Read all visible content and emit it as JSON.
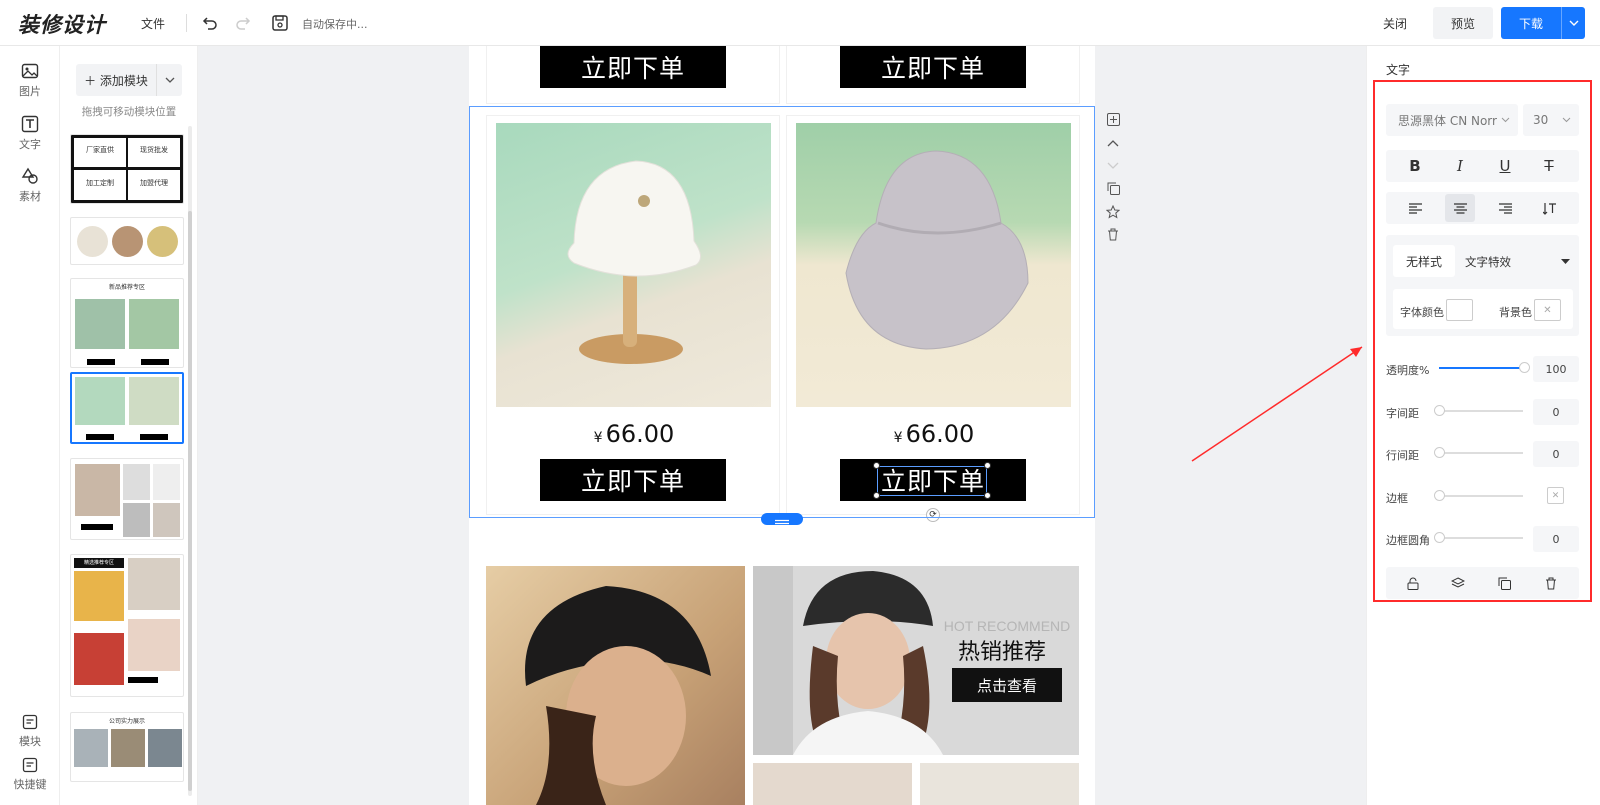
{
  "header": {
    "logo": "装修设计",
    "file_menu": "文件",
    "autosave_status": "自动保存中...",
    "close_label": "关闭",
    "preview_label": "预览",
    "download_label": "下载"
  },
  "rail": {
    "items": [
      {
        "label": "图片",
        "icon": "image-icon"
      },
      {
        "label": "文字",
        "icon": "text-icon"
      },
      {
        "label": "素材",
        "icon": "shapes-icon"
      }
    ],
    "bottom": [
      {
        "label": "模块",
        "icon": "module-icon"
      },
      {
        "label": "快捷键",
        "icon": "keyboard-icon"
      }
    ]
  },
  "module_panel": {
    "add_label": "添加模块",
    "hint": "拖拽可移动模块位置",
    "thumb1_cells": [
      "厂家直供",
      "现货批发",
      "加工定制",
      "加盟代理"
    ],
    "thumb3_title": "新品推荐专区",
    "thumb5_label": "精选推荐专区",
    "thumb6_title": "公司实力展示"
  },
  "canvas": {
    "top_buy_left": "立即下单",
    "top_buy_right": "立即下单",
    "product_left": {
      "currency": "¥",
      "price": "66.00",
      "button": "立即下单"
    },
    "product_right": {
      "currency": "¥",
      "price": "66.00",
      "button": "立即下单"
    },
    "banner": {
      "subtitle": "HOT RECOMMEND",
      "title": "热销推荐",
      "button": "点击查看"
    }
  },
  "props": {
    "section_title": "文字",
    "font_family": "思源黑体 CN Norr",
    "font_size": "30",
    "style_tab": "无样式",
    "effect_tab": "文字特效",
    "font_color_label": "字体颜色",
    "bg_color_label": "背景色",
    "opacity_label": "透明度%",
    "opacity_value": "100",
    "letter_spacing_label": "字间距",
    "letter_spacing_value": "0",
    "line_height_label": "行间距",
    "line_height_value": "0",
    "border_label": "边框",
    "radius_label": "边框圆角",
    "radius_value": "0"
  },
  "colors": {
    "accent": "#1677ff",
    "highlight": "#ff2b2b"
  }
}
